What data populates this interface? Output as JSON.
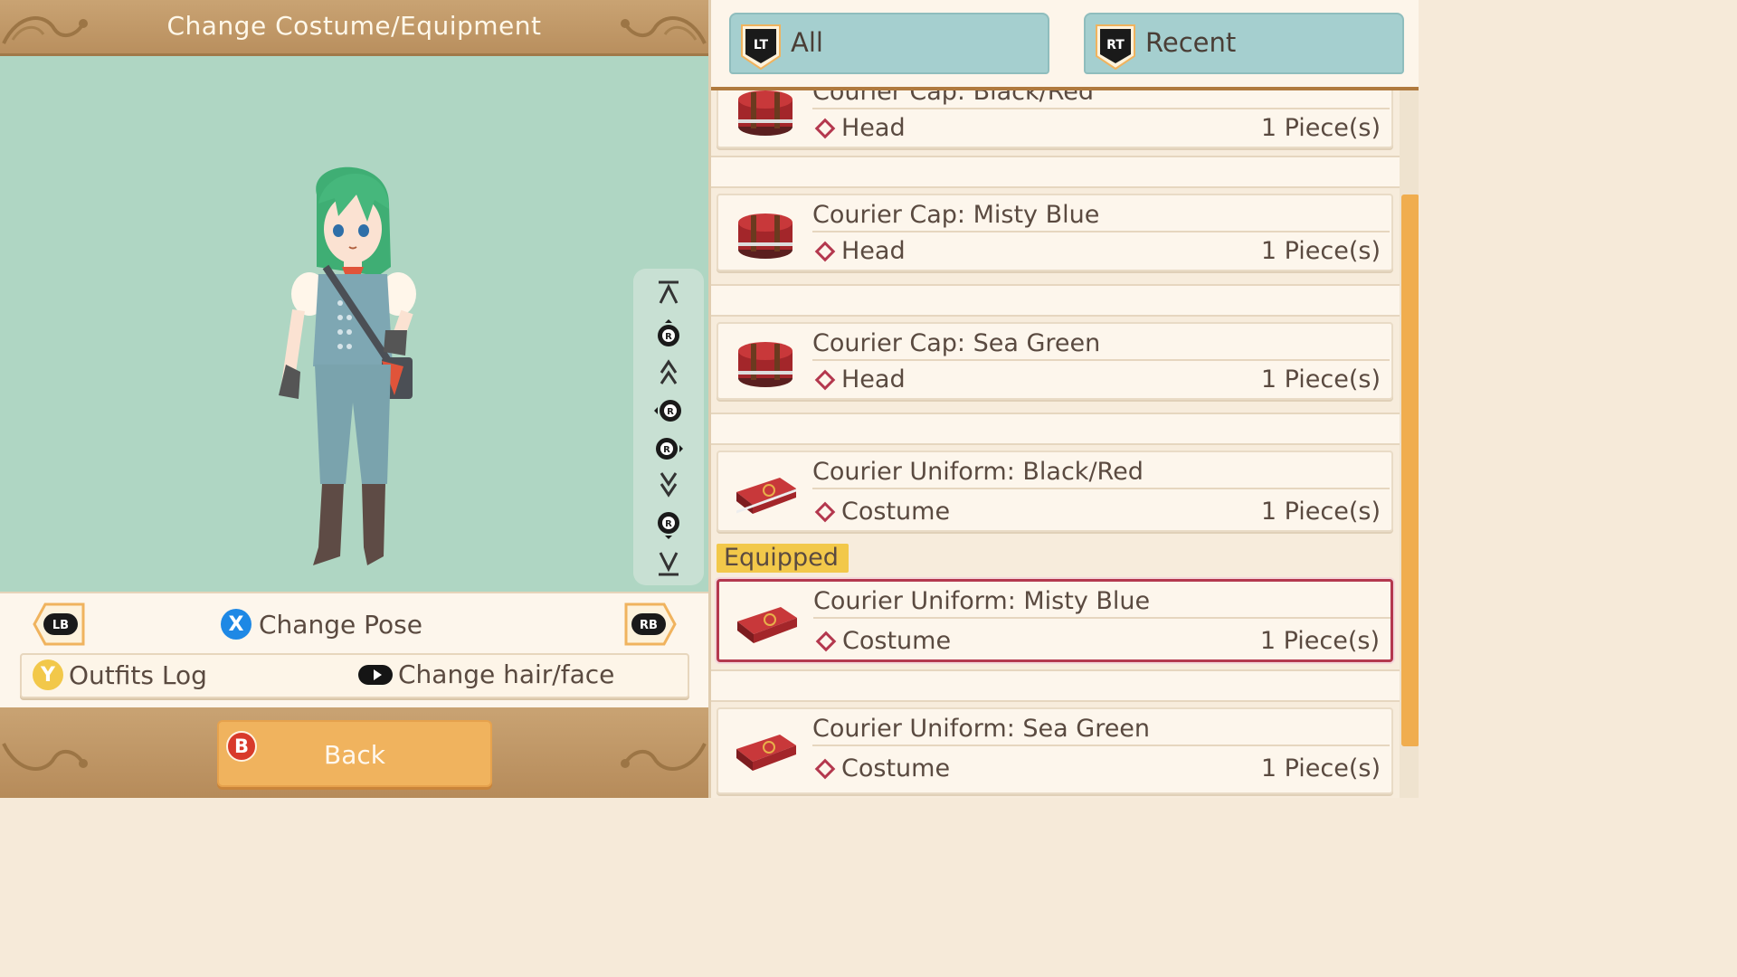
{
  "header": {
    "title": "Change Costume/Equipment"
  },
  "preview": {
    "camera_controls": [
      "camera-top-icon",
      "camera-up-icon",
      "zoom-in-icon",
      "rotate-left-icon",
      "rotate-right-icon",
      "zoom-out-icon",
      "camera-down-icon",
      "camera-bottom-icon"
    ]
  },
  "controls": {
    "lb_label": "LB",
    "rb_label": "RB",
    "pose_button": "X",
    "pose_label": "Change Pose",
    "outfits_button": "Y",
    "outfits_label": "Outfits Log",
    "hair_label": "Change hair/face"
  },
  "back": {
    "button": "B",
    "label": "Back"
  },
  "filters": [
    {
      "badge": "LT",
      "label": "All"
    },
    {
      "badge": "RT",
      "label": "Recent"
    }
  ],
  "equipped_label": "Equipped",
  "items": [
    {
      "name": "Courier Cap: Black/Red",
      "category": "Head",
      "qty": "1 Piece(s)",
      "icon": "cap-box-icon",
      "equipped": false
    },
    {
      "name": "Courier Cap: Misty Blue",
      "category": "Head",
      "qty": "1 Piece(s)",
      "icon": "cap-box-icon",
      "equipped": false
    },
    {
      "name": "Courier Cap: Sea Green",
      "category": "Head",
      "qty": "1 Piece(s)",
      "icon": "cap-box-icon",
      "equipped": false
    },
    {
      "name": "Courier Uniform: Black/Red",
      "category": "Costume",
      "qty": "1 Piece(s)",
      "icon": "costume-case-icon",
      "equipped": false
    },
    {
      "name": "Courier Uniform: Misty Blue",
      "category": "Costume",
      "qty": "1 Piece(s)",
      "icon": "costume-case-icon",
      "equipped": true
    },
    {
      "name": "Courier Uniform: Sea Green",
      "category": "Costume",
      "qty": "1 Piece(s)",
      "icon": "costume-case-icon",
      "equipped": false
    }
  ],
  "colors": {
    "accent": "#f0ad4e",
    "equipped_border": "#b4384e",
    "preview_bg": "#afd6c3",
    "tab_bg": "#a5cfcf"
  }
}
